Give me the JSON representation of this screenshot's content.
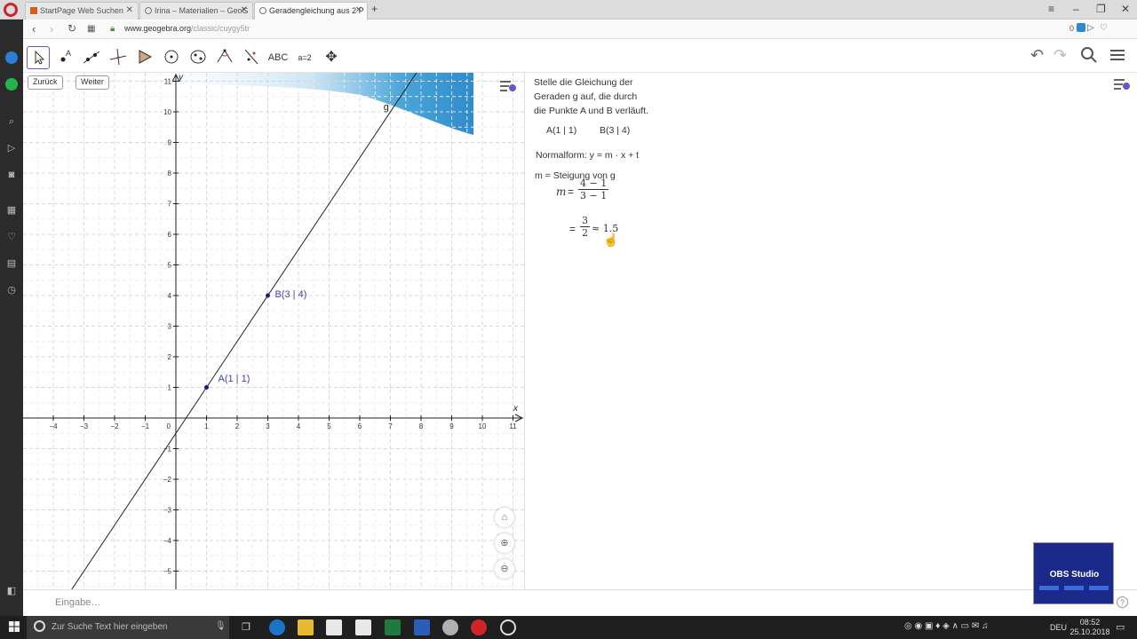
{
  "browser": {
    "tabs": [
      {
        "label": "StartPage Web Suchen"
      },
      {
        "label": "Irina – Materialien – GeoG"
      },
      {
        "label": "Geradengleichung aus 2 P"
      }
    ],
    "url_host": "www.geogebra.org",
    "url_path": "/classic/cuygy5tr",
    "badge_count": "0"
  },
  "geogebra": {
    "toolbar": {
      "text_tool_label": "ABC",
      "slider_tool_label": "a=2"
    },
    "graphics": {
      "back_button": "Zurück",
      "next_button": "Weiter",
      "x_axis_label": "x",
      "y_axis_label": "y",
      "x_ticks": [
        "−4",
        "−3",
        "−2",
        "−1",
        "1",
        "2",
        "3",
        "4",
        "5",
        "6",
        "7",
        "8",
        "9",
        "10",
        "11"
      ],
      "y_ticks": [
        "11",
        "10",
        "9",
        "8",
        "7",
        "6",
        "5",
        "4",
        "3",
        "2",
        "1",
        "−1",
        "−2",
        "−3",
        "−4",
        "−5"
      ],
      "origin_label": "0",
      "line_label": "g",
      "point_a_label": "A(1 | 1)",
      "point_b_label": "B(3 | 4)",
      "points": [
        {
          "name": "A",
          "x": 1,
          "y": 1
        },
        {
          "name": "B",
          "x": 3,
          "y": 4
        }
      ],
      "line_slope": 1.5,
      "line_intercept": -0.5
    },
    "algebra": {
      "task_line1": "Stelle die Gleichung der",
      "task_line2": "Geraden g auf, die durch",
      "task_line3": "die Punkte A und B verläuft.",
      "point_a": "A(1 | 1)",
      "point_b": "B(3 | 4)",
      "normal_form": "Normalform: y = m · x + t",
      "slope_def": "m = Steigung von g",
      "m_var": "m",
      "eq1": "=",
      "frac1_num": "4 − 1",
      "frac1_den": "3 − 1",
      "eq2": "=",
      "frac2_num": "3",
      "frac2_den": "2",
      "approx": "≈ 1.5"
    },
    "input_placeholder": "Eingabe…"
  },
  "obs": {
    "title": "OBS Studio"
  },
  "taskbar": {
    "search_placeholder": "Zur Suche Text hier eingeben",
    "language": "DEU",
    "time": "08:52",
    "date": "25.10.2018"
  },
  "colors": {
    "point_color": "#1a1a80",
    "label_color": "#4040b0",
    "accent": "#6557d2"
  }
}
